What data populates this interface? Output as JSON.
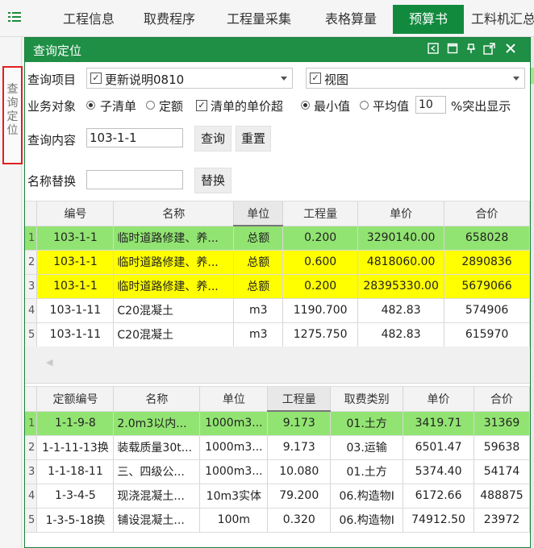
{
  "tabs": [
    {
      "label": "工程信息",
      "active": false
    },
    {
      "label": "取费程序",
      "active": false
    },
    {
      "label": "工程量采集",
      "active": false
    },
    {
      "label": "表格算量",
      "active": false
    },
    {
      "label": "预算书",
      "active": true
    },
    {
      "label": "工料机汇总",
      "active": false
    }
  ],
  "sidebar": {
    "label": "查询定位"
  },
  "dialog": {
    "title": "查询定位",
    "query_item": {
      "label": "查询项目",
      "select1": {
        "checked": true,
        "value": "更新说明0810"
      },
      "select2": {
        "checked": true,
        "value": "视图"
      }
    },
    "business_object": {
      "label": "业务对象",
      "option_bill": "子清单",
      "option_quota": "定额",
      "check_label": "清单的单价超",
      "option_min": "最小值",
      "option_avg": "平均值",
      "threshold": "10",
      "suffix": "%突出显示"
    },
    "query_content": {
      "label": "查询内容",
      "value": "103-1-1",
      "search_button": "查询",
      "reset_button": "重置"
    },
    "name_replace": {
      "label": "名称替换",
      "value": "",
      "replace_button": "替换"
    }
  },
  "bill_table": {
    "columns": [
      "编号",
      "名称",
      "单位",
      "工程量",
      "单价",
      "合价"
    ],
    "rows": [
      {
        "idx": "1",
        "code": "103-1-1",
        "name": "临时道路修建、养...",
        "unit": "总额",
        "qty": "0.200",
        "price": "3290140.00",
        "total": "658028",
        "highlight": "green"
      },
      {
        "idx": "2",
        "code": "103-1-1",
        "name": "临时道路修建、养...",
        "unit": "总额",
        "qty": "0.600",
        "price": "4818060.00",
        "total": "2890836",
        "highlight": "yellow"
      },
      {
        "idx": "3",
        "code": "103-1-1",
        "name": "临时道路修建、养...",
        "unit": "总额",
        "qty": "0.200",
        "price": "28395330.00",
        "total": "5679066",
        "highlight": "yellow"
      },
      {
        "idx": "4",
        "code": "103-1-11",
        "name": "C20混凝土",
        "unit": "m3",
        "qty": "1190.700",
        "price": "482.83",
        "total": "574906",
        "highlight": ""
      },
      {
        "idx": "5",
        "code": "103-1-11",
        "name": "C20混凝土",
        "unit": "m3",
        "qty": "1275.750",
        "price": "482.83",
        "total": "615970",
        "highlight": ""
      }
    ]
  },
  "quota_table": {
    "columns": [
      "定额编号",
      "名称",
      "单位",
      "工程量",
      "取费类别",
      "单价",
      "合价"
    ],
    "rows": [
      {
        "idx": "1",
        "code": "1-1-9-8",
        "name": "2.0m3以内...",
        "unit": "1000m3...",
        "qty": "9.173",
        "category": "01.土方",
        "price": "3419.71",
        "total": "31369",
        "highlight": "green"
      },
      {
        "idx": "2",
        "code": "1-1-11-13换",
        "name": "装载质量30t...",
        "unit": "1000m3...",
        "qty": "9.173",
        "category": "03.运输",
        "price": "6501.47",
        "total": "59638",
        "highlight": ""
      },
      {
        "idx": "3",
        "code": "1-1-18-11",
        "name": "三、四级公...",
        "unit": "1000m3...",
        "qty": "10.080",
        "category": "01.土方",
        "price": "5374.40",
        "total": "54174",
        "highlight": ""
      },
      {
        "idx": "4",
        "code": "1-3-4-5",
        "name": "现浇混凝土...",
        "unit": "10m3实体",
        "qty": "79.200",
        "category": "06.构造物Ⅰ",
        "price": "6172.66",
        "total": "488875",
        "highlight": ""
      },
      {
        "idx": "5",
        "code": "1-3-5-18换",
        "name": "铺设混凝土...",
        "unit": "100m",
        "qty": "0.320",
        "category": "06.构造物Ⅰ",
        "price": "74912.50",
        "total": "23972",
        "highlight": ""
      }
    ]
  },
  "colors": {
    "brand_green": "#1e8f45",
    "row_green": "#92e472",
    "row_yellow": "#ffff00",
    "locator_border": "#e02020"
  }
}
